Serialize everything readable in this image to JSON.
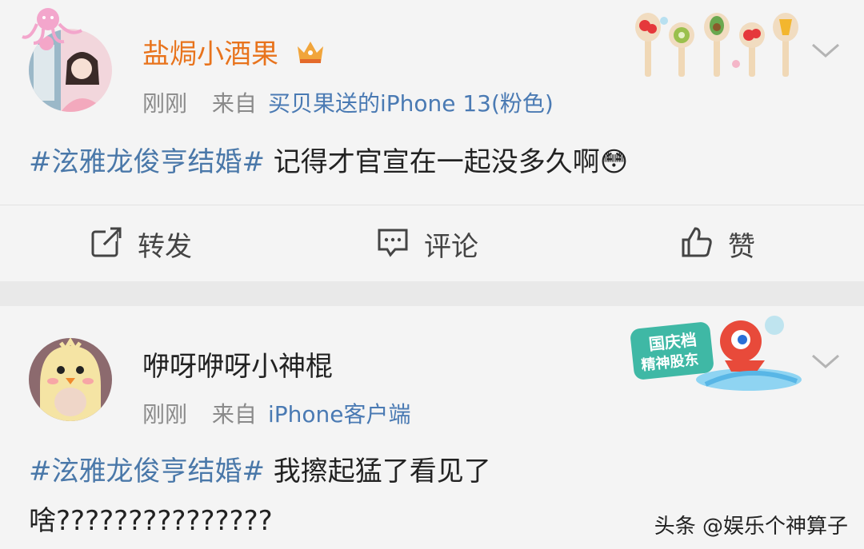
{
  "posts": [
    {
      "username": "盐焗小酒果",
      "time": "刚刚",
      "from_label": "来自",
      "source": "买贝果送的iPhone 13(粉色)",
      "hashtag": "#泫雅龙俊亨结婚#",
      "text": " 记得才官宣在一起没多久啊😳",
      "text_line2": "",
      "icons": {
        "avatar": "avatar-girl-photo",
        "badge": "crown-icon",
        "more": "chevron-down-icon"
      }
    },
    {
      "username": "咿呀咿呀小神棍",
      "time": "刚刚",
      "from_label": "来自",
      "source": "iPhone客户端",
      "hashtag": "#泫雅龙俊亨结婚#",
      "text": " 我擦起猛了看见了",
      "text_line2": "啥???????????????",
      "icons": {
        "avatar": "avatar-chick-hat-photo",
        "badge": "guoqing-sticker",
        "more": "chevron-down-icon"
      }
    }
  ],
  "actions": {
    "repost": "转发",
    "comment": "评论",
    "like": "赞"
  },
  "sticker_text": {
    "line1": "国庆档",
    "line2": "精神股东"
  },
  "watermark": "头条 @娱乐个神算子",
  "colors": {
    "link": "#4a78a9",
    "username_orange": "#e8731c",
    "meta_gray": "#8a8a8a"
  }
}
